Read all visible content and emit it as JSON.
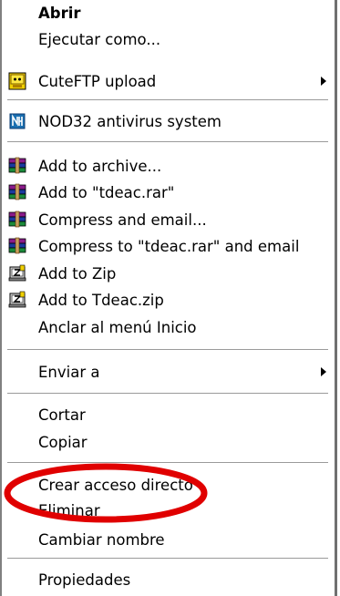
{
  "menu": {
    "items": [
      {
        "label": "Abrir",
        "icon": "",
        "bold": true
      },
      {
        "label": "Ejecutar como...",
        "icon": ""
      },
      {
        "label": "CuteFTP upload",
        "icon": "cuteftp-icon",
        "submenu": true
      },
      {
        "label": "NOD32 antivirus system",
        "icon": "nod32-icon"
      },
      {
        "label": "Add to archive...",
        "icon": "winrar-icon"
      },
      {
        "label": "Add to \"tdeac.rar\"",
        "icon": "winrar-icon"
      },
      {
        "label": "Compress and email...",
        "icon": "winrar-icon"
      },
      {
        "label": "Compress to \"tdeac.rar\" and email",
        "icon": "winrar-icon"
      },
      {
        "label": "Add to Zip",
        "icon": "winzip-icon"
      },
      {
        "label": "Add to Tdeac.zip",
        "icon": "winzip-icon"
      },
      {
        "label": "Anclar al menú Inicio",
        "icon": ""
      },
      {
        "label": "Enviar a",
        "icon": "",
        "submenu": true
      },
      {
        "label": "Cortar",
        "icon": ""
      },
      {
        "label": "Copiar",
        "icon": ""
      },
      {
        "label": "Crear acceso directo",
        "icon": "",
        "highlighted": true
      },
      {
        "label": "Eliminar",
        "icon": ""
      },
      {
        "label": "Cambiar nombre",
        "icon": ""
      },
      {
        "label": "Propiedades",
        "icon": ""
      }
    ]
  },
  "colors": {
    "highlight_ellipse": "#e00000",
    "separator": "#9a9a9a",
    "border": "#808080"
  }
}
